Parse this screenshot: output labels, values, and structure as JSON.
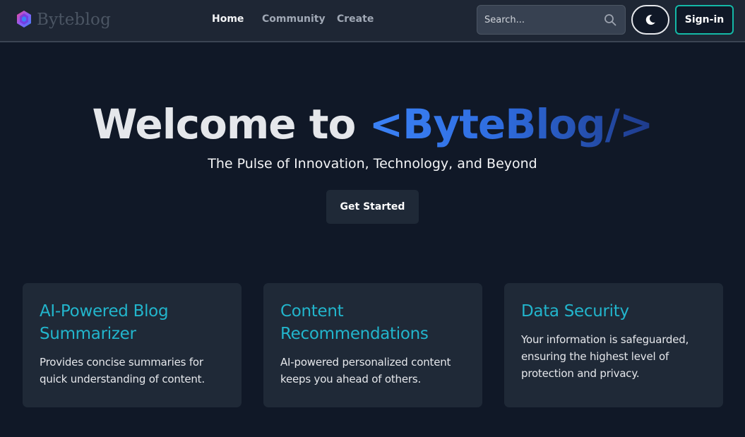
{
  "navbar": {
    "brand_name": "Byteblog",
    "brand_logo": "hexagon-gradient-logo",
    "links": [
      {
        "label": "Home",
        "active": true
      },
      {
        "label": "Community",
        "active": false
      },
      {
        "label": "Create",
        "active": false
      }
    ],
    "search": {
      "placeholder": "Search...",
      "value": "",
      "icon": "search-icon"
    },
    "theme_toggle_icon": "moon-icon",
    "signin_label": "Sign-in"
  },
  "hero": {
    "title_plain": "Welcome to ",
    "title_brand": "<ByteBlog/>",
    "subtitle": "The Pulse of Innovation, Technology, and Beyond",
    "cta_label": "Get Started"
  },
  "features": [
    {
      "title": "AI-Powered Blog Summarizer",
      "text": "Provides concise summaries for quick understanding of content."
    },
    {
      "title": "Content Recommendations",
      "text": "AI-powered personalized content keeps you ahead of others."
    },
    {
      "title": "Data Security",
      "text": "Your information is safeguarded, ensuring the highest level of protection and privacy."
    }
  ],
  "colors": {
    "background": "#101827",
    "navbar": "#1e2634",
    "card": "#1f2937",
    "accent_teal": "#14b8a6",
    "feature_title": "#22b5cc",
    "brand_blue": "#3b82f6"
  }
}
